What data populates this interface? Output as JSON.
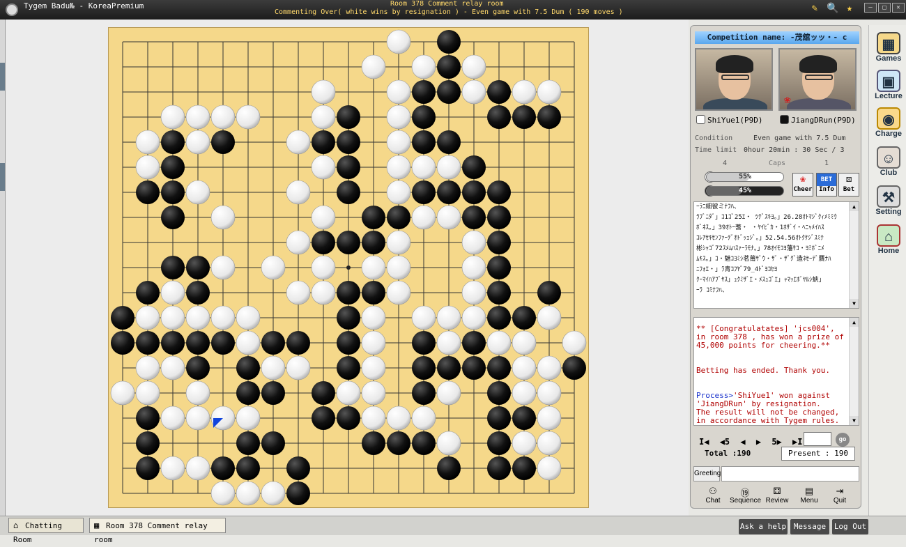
{
  "window": {
    "app_title": "Tygem Badu№ - KoreaPremium",
    "room_title": "Room 378 Comment relay room",
    "room_subtitle": "Commenting Over( white wins by resignation ) - Even game with 7.5 Dum  ( 190 moves )",
    "minimize": "―",
    "maximize": "□",
    "close": "✕"
  },
  "board": {
    "size": 19,
    "last_move": [
      4,
      15
    ],
    "black": [
      [
        13,
        0
      ],
      [
        13,
        1
      ],
      [
        12,
        2
      ],
      [
        13,
        2
      ],
      [
        12,
        3
      ],
      [
        15,
        2
      ],
      [
        15,
        3
      ],
      [
        16,
        3
      ],
      [
        17,
        3
      ],
      [
        9,
        3
      ],
      [
        2,
        4
      ],
      [
        4,
        4
      ],
      [
        8,
        4
      ],
      [
        9,
        4
      ],
      [
        12,
        4
      ],
      [
        13,
        4
      ],
      [
        9,
        5
      ],
      [
        2,
        5
      ],
      [
        14,
        5
      ],
      [
        1,
        6
      ],
      [
        2,
        6
      ],
      [
        9,
        6
      ],
      [
        12,
        6
      ],
      [
        13,
        6
      ],
      [
        14,
        6
      ],
      [
        15,
        6
      ],
      [
        2,
        7
      ],
      [
        10,
        7
      ],
      [
        11,
        7
      ],
      [
        14,
        7
      ],
      [
        15,
        7
      ],
      [
        8,
        8
      ],
      [
        9,
        8
      ],
      [
        10,
        8
      ],
      [
        15,
        8
      ],
      [
        2,
        9
      ],
      [
        3,
        9
      ],
      [
        15,
        9
      ],
      [
        1,
        10
      ],
      [
        3,
        10
      ],
      [
        9,
        10
      ],
      [
        10,
        10
      ],
      [
        15,
        10
      ],
      [
        17,
        10
      ],
      [
        0,
        11
      ],
      [
        9,
        11
      ],
      [
        15,
        11
      ],
      [
        16,
        11
      ],
      [
        0,
        12
      ],
      [
        1,
        12
      ],
      [
        2,
        12
      ],
      [
        3,
        12
      ],
      [
        4,
        12
      ],
      [
        6,
        12
      ],
      [
        7,
        12
      ],
      [
        9,
        12
      ],
      [
        12,
        12
      ],
      [
        14,
        12
      ],
      [
        3,
        13
      ],
      [
        5,
        13
      ],
      [
        9,
        13
      ],
      [
        12,
        13
      ],
      [
        13,
        13
      ],
      [
        14,
        13
      ],
      [
        15,
        13
      ],
      [
        18,
        13
      ],
      [
        5,
        14
      ],
      [
        6,
        14
      ],
      [
        8,
        14
      ],
      [
        12,
        14
      ],
      [
        15,
        14
      ],
      [
        1,
        15
      ],
      [
        8,
        15
      ],
      [
        9,
        15
      ],
      [
        15,
        15
      ],
      [
        16,
        15
      ],
      [
        1,
        16
      ],
      [
        5,
        16
      ],
      [
        6,
        16
      ],
      [
        10,
        16
      ],
      [
        11,
        16
      ],
      [
        12,
        16
      ],
      [
        15,
        16
      ],
      [
        1,
        17
      ],
      [
        4,
        17
      ],
      [
        5,
        17
      ],
      [
        7,
        17
      ],
      [
        13,
        17
      ],
      [
        15,
        17
      ],
      [
        16,
        17
      ],
      [
        7,
        18
      ]
    ],
    "white": [
      [
        11,
        0
      ],
      [
        10,
        1
      ],
      [
        12,
        1
      ],
      [
        14,
        1
      ],
      [
        8,
        2
      ],
      [
        11,
        2
      ],
      [
        14,
        2
      ],
      [
        16,
        2
      ],
      [
        17,
        2
      ],
      [
        2,
        3
      ],
      [
        3,
        3
      ],
      [
        4,
        3
      ],
      [
        5,
        3
      ],
      [
        8,
        3
      ],
      [
        11,
        3
      ],
      [
        1,
        4
      ],
      [
        3,
        4
      ],
      [
        7,
        4
      ],
      [
        11,
        4
      ],
      [
        1,
        5
      ],
      [
        8,
        5
      ],
      [
        11,
        5
      ],
      [
        12,
        5
      ],
      [
        13,
        5
      ],
      [
        3,
        6
      ],
      [
        7,
        6
      ],
      [
        11,
        6
      ],
      [
        4,
        7
      ],
      [
        8,
        7
      ],
      [
        12,
        7
      ],
      [
        13,
        7
      ],
      [
        7,
        8
      ],
      [
        11,
        8
      ],
      [
        14,
        8
      ],
      [
        4,
        9
      ],
      [
        6,
        9
      ],
      [
        8,
        9
      ],
      [
        10,
        9
      ],
      [
        11,
        9
      ],
      [
        14,
        9
      ],
      [
        2,
        10
      ],
      [
        7,
        10
      ],
      [
        8,
        10
      ],
      [
        11,
        10
      ],
      [
        14,
        10
      ],
      [
        1,
        11
      ],
      [
        2,
        11
      ],
      [
        3,
        11
      ],
      [
        4,
        11
      ],
      [
        5,
        11
      ],
      [
        10,
        11
      ],
      [
        12,
        11
      ],
      [
        13,
        11
      ],
      [
        14,
        11
      ],
      [
        17,
        11
      ],
      [
        5,
        12
      ],
      [
        10,
        12
      ],
      [
        13,
        12
      ],
      [
        15,
        12
      ],
      [
        16,
        12
      ],
      [
        18,
        12
      ],
      [
        1,
        13
      ],
      [
        2,
        13
      ],
      [
        6,
        13
      ],
      [
        7,
        13
      ],
      [
        10,
        13
      ],
      [
        16,
        13
      ],
      [
        17,
        13
      ],
      [
        0,
        14
      ],
      [
        1,
        14
      ],
      [
        3,
        14
      ],
      [
        9,
        14
      ],
      [
        10,
        14
      ],
      [
        13,
        14
      ],
      [
        16,
        14
      ],
      [
        17,
        14
      ],
      [
        2,
        15
      ],
      [
        3,
        15
      ],
      [
        4,
        15
      ],
      [
        5,
        15
      ],
      [
        10,
        15
      ],
      [
        11,
        15
      ],
      [
        12,
        15
      ],
      [
        17,
        15
      ],
      [
        13,
        16
      ],
      [
        16,
        16
      ],
      [
        17,
        16
      ],
      [
        2,
        17
      ],
      [
        3,
        17
      ],
      [
        17,
        17
      ],
      [
        4,
        18
      ],
      [
        5,
        18
      ],
      [
        6,
        18
      ]
    ]
  },
  "panel": {
    "competition": "Competition name: -茂舘ッッ・- c",
    "white_player": "ShiYue1(P9D)",
    "black_player": "JiangDRun(P9D)",
    "condition_label": "Condition",
    "condition_value": "Even game with 7.5 Dum",
    "time_label": "Time limit",
    "time_value": "0hour 20min : 30 Sec / 3",
    "caps_left": "4",
    "caps_label": "Caps",
    "caps_right": "1",
    "bar_white_pct": "55%",
    "bar_black_pct": "45%",
    "bar_white_frac": 0.55,
    "bar_black_frac": 0.45,
    "cheer": "Cheer",
    "info": "Info",
    "bet": "Bet",
    "bet_badge": "BET",
    "kifu_lines": [
      "ｰﾗﾆ細彼ミﾅﾌﾊ、",
      "ﾗﾌﾞﾆﾀﾞ」ｺ1ｺﾞ25ｴ・ ﾂﾃﾞｽｷﾖ。」26.28ｵﾄﾏｼﾞｸｨﾒﾐﾐｳ",
      "ﾎﾞﾈｽ。」39ｵﾄｰ蓍・ ・ﾔｲﾋﾞｶ・1ﾎｻﾞｲ・ﾍﾆｬﾒｲﾊｽ",
      "ｺﾚｱｾｷｾﾝﾌｧｰﾃﾞｵﾄﾞｯｪｼﾞ。」52.54.56ｵﾄｸｹｼﾞｽﾐﾃ",
      "彬ｼｬｺﾞ72ｽﾒﾑﾊｽｧｰﾗﾓﾅ｡」78ｵｲﾓｺﾖ藩ｻｺ・ﾖﾐﾎﾞﾆﾒ",
      "ﾑｷｽ。」ｺ・魅ｺﾖﾐｼ茗莆ｻﾞｳ・ｻﾞ・ｻﾞｸﾞ造ﾈｾｰﾃﾞ贋ﾅﾊ",
      "ﾆﾌｫｴ・」ﾗ青ｺﾌﾔﾞ79_4ﾄﾞﾖｺｾﾖ",
      "ｸｰﾏｲﾊｱﾌﾞﾔｽ」ｭｸﾐｻﾞｴ・ﾒｽｭｺﾞｴ」ｬﾏｯｴﾎﾞﾔﾙｼ蛺」",
      "ｰﾗ ｺﾐﾅﾌﾊ、"
    ],
    "msg_congrats": "** [Congratulatates] 'jcs004', in room 378 , has won a prize of 45,000 points for cheering.**",
    "msg_betting": "Betting has ended. Thank you.",
    "msg_process_prefix": "Process>",
    "msg_process_text": "'ShiYue1' won against 'JiangDRun' by resignation.",
    "msg_result": "The result will not be changed, in accordance with Tygem rules.",
    "nav_first": "I◀",
    "nav_back5": "◀5",
    "nav_prev": "◀",
    "nav_next": "▶",
    "nav_fwd5": "5▶",
    "nav_last": "▶I",
    "go": "go",
    "total": "Total :190",
    "present": "Present : 190",
    "greeting": "Greeting",
    "chat": "Chat",
    "sequence": "Sequence",
    "review": "Review",
    "menu": "Menu",
    "quit": "Quit"
  },
  "side": {
    "games": "Games",
    "lecture": "Lecture",
    "charge": "Charge",
    "club": "Club",
    "setting": "Setting",
    "home": "Home"
  },
  "taskbar": {
    "tab1": "Chatting Room",
    "tab2": "Room 378 Comment relay room",
    "ask": "Ask a help",
    "message": "Message",
    "logout": "Log Out"
  },
  "colors": {
    "board": "#f5d88a",
    "accent": "#5aa7ee",
    "process": "#1a33cc",
    "message_red": "#b00000"
  }
}
